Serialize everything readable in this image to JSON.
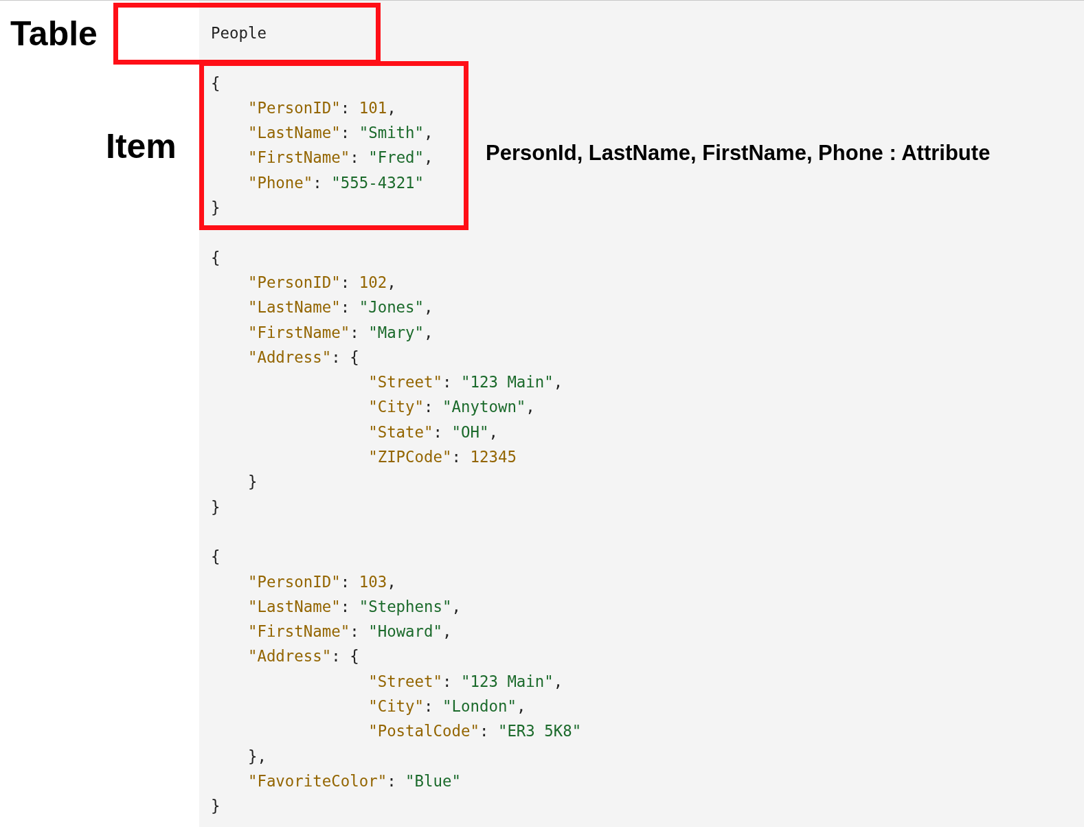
{
  "annotations": {
    "table_label": "Table",
    "item_label": "Item",
    "attribute_note": "PersonId, LastName, FirstName, Phone : Attribute"
  },
  "code": {
    "title": "People",
    "blocks": [
      {
        "lines": [
          [
            {
              "kind": "punct",
              "text": "{"
            }
          ],
          [
            {
              "kind": "key",
              "text": "    \"PersonID\""
            },
            {
              "kind": "punct",
              "text": ": "
            },
            {
              "kind": "number",
              "text": "101"
            },
            {
              "kind": "punct",
              "text": ","
            }
          ],
          [
            {
              "kind": "key",
              "text": "    \"LastName\""
            },
            {
              "kind": "punct",
              "text": ": "
            },
            {
              "kind": "string",
              "text": "\"Smith\""
            },
            {
              "kind": "punct",
              "text": ","
            }
          ],
          [
            {
              "kind": "key",
              "text": "    \"FirstName\""
            },
            {
              "kind": "punct",
              "text": ": "
            },
            {
              "kind": "string",
              "text": "\"Fred\""
            },
            {
              "kind": "punct",
              "text": ","
            }
          ],
          [
            {
              "kind": "key",
              "text": "    \"Phone\""
            },
            {
              "kind": "punct",
              "text": ": "
            },
            {
              "kind": "string",
              "text": "\"555-4321\""
            }
          ],
          [
            {
              "kind": "punct",
              "text": "}"
            }
          ]
        ]
      },
      {
        "lines": [
          [
            {
              "kind": "punct",
              "text": "{"
            }
          ],
          [
            {
              "kind": "key",
              "text": "    \"PersonID\""
            },
            {
              "kind": "punct",
              "text": ": "
            },
            {
              "kind": "number",
              "text": "102"
            },
            {
              "kind": "punct",
              "text": ","
            }
          ],
          [
            {
              "kind": "key",
              "text": "    \"LastName\""
            },
            {
              "kind": "punct",
              "text": ": "
            },
            {
              "kind": "string",
              "text": "\"Jones\""
            },
            {
              "kind": "punct",
              "text": ","
            }
          ],
          [
            {
              "kind": "key",
              "text": "    \"FirstName\""
            },
            {
              "kind": "punct",
              "text": ": "
            },
            {
              "kind": "string",
              "text": "\"Mary\""
            },
            {
              "kind": "punct",
              "text": ","
            }
          ],
          [
            {
              "kind": "key",
              "text": "    \"Address\""
            },
            {
              "kind": "punct",
              "text": ": {"
            }
          ],
          [
            {
              "kind": "key",
              "text": "                 \"Street\""
            },
            {
              "kind": "punct",
              "text": ": "
            },
            {
              "kind": "string",
              "text": "\"123 Main\""
            },
            {
              "kind": "punct",
              "text": ","
            }
          ],
          [
            {
              "kind": "key",
              "text": "                 \"City\""
            },
            {
              "kind": "punct",
              "text": ": "
            },
            {
              "kind": "string",
              "text": "\"Anytown\""
            },
            {
              "kind": "punct",
              "text": ","
            }
          ],
          [
            {
              "kind": "key",
              "text": "                 \"State\""
            },
            {
              "kind": "punct",
              "text": ": "
            },
            {
              "kind": "string",
              "text": "\"OH\""
            },
            {
              "kind": "punct",
              "text": ","
            }
          ],
          [
            {
              "kind": "key",
              "text": "                 \"ZIPCode\""
            },
            {
              "kind": "punct",
              "text": ": "
            },
            {
              "kind": "number",
              "text": "12345"
            }
          ],
          [
            {
              "kind": "punct",
              "text": "    }"
            }
          ],
          [
            {
              "kind": "punct",
              "text": "}"
            }
          ]
        ]
      },
      {
        "lines": [
          [
            {
              "kind": "punct",
              "text": "{"
            }
          ],
          [
            {
              "kind": "key",
              "text": "    \"PersonID\""
            },
            {
              "kind": "punct",
              "text": ": "
            },
            {
              "kind": "number",
              "text": "103"
            },
            {
              "kind": "punct",
              "text": ","
            }
          ],
          [
            {
              "kind": "key",
              "text": "    \"LastName\""
            },
            {
              "kind": "punct",
              "text": ": "
            },
            {
              "kind": "string",
              "text": "\"Stephens\""
            },
            {
              "kind": "punct",
              "text": ","
            }
          ],
          [
            {
              "kind": "key",
              "text": "    \"FirstName\""
            },
            {
              "kind": "punct",
              "text": ": "
            },
            {
              "kind": "string",
              "text": "\"Howard\""
            },
            {
              "kind": "punct",
              "text": ","
            }
          ],
          [
            {
              "kind": "key",
              "text": "    \"Address\""
            },
            {
              "kind": "punct",
              "text": ": {"
            }
          ],
          [
            {
              "kind": "key",
              "text": "                 \"Street\""
            },
            {
              "kind": "punct",
              "text": ": "
            },
            {
              "kind": "string",
              "text": "\"123 Main\""
            },
            {
              "kind": "punct",
              "text": ","
            }
          ],
          [
            {
              "kind": "key",
              "text": "                 \"City\""
            },
            {
              "kind": "punct",
              "text": ": "
            },
            {
              "kind": "string",
              "text": "\"London\""
            },
            {
              "kind": "punct",
              "text": ","
            }
          ],
          [
            {
              "kind": "key",
              "text": "                 \"PostalCode\""
            },
            {
              "kind": "punct",
              "text": ": "
            },
            {
              "kind": "string",
              "text": "\"ER3 5K8\""
            }
          ],
          [
            {
              "kind": "punct",
              "text": "    },"
            }
          ],
          [
            {
              "kind": "key",
              "text": "    \"FavoriteColor\""
            },
            {
              "kind": "punct",
              "text": ": "
            },
            {
              "kind": "string",
              "text": "\"Blue\""
            }
          ],
          [
            {
              "kind": "punct",
              "text": "}"
            }
          ]
        ]
      }
    ]
  }
}
